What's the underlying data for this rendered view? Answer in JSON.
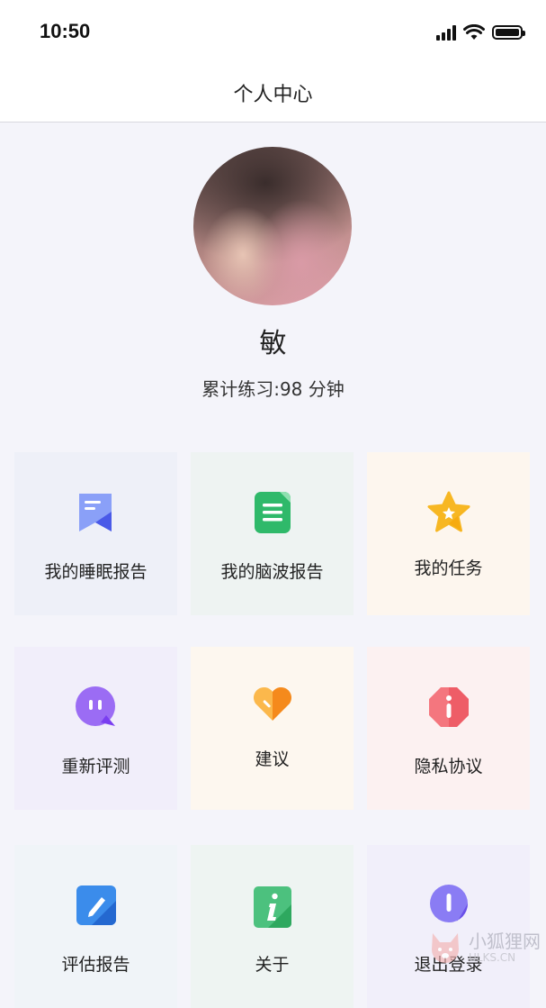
{
  "status_bar": {
    "time": "10:50"
  },
  "header": {
    "title": "个人中心"
  },
  "profile": {
    "name": "敏",
    "practice_text": "累计练习:98 分钟"
  },
  "menu": {
    "items": [
      {
        "label": "我的睡眠报告",
        "icon": "sleep-report-icon",
        "bg": "#eef0f8",
        "color": "#5b6cf0"
      },
      {
        "label": "我的脑波报告",
        "icon": "brainwave-report-icon",
        "bg": "#eef3f2",
        "color": "#2fb96a"
      },
      {
        "label": "我的任务",
        "icon": "star-task-icon",
        "bg": "#fdf6ee",
        "color": "#f5b21c"
      },
      {
        "label": "重新评测",
        "icon": "chat-retest-icon",
        "bg": "#f1eefa",
        "color": "#8a5cf0"
      },
      {
        "label": "建议",
        "icon": "heart-suggestion-icon",
        "bg": "#fdf7ef",
        "color": "#f5a623"
      },
      {
        "label": "隐私协议",
        "icon": "info-privacy-icon",
        "bg": "#fcf1f1",
        "color": "#ef5a64"
      },
      {
        "label": "评估报告",
        "icon": "pen-report-icon",
        "bg": "#f0f4f8",
        "color": "#2f7ee0"
      },
      {
        "label": "关于",
        "icon": "info-about-icon",
        "bg": "#eef4f2",
        "color": "#3cb96e"
      },
      {
        "label": "退出登录",
        "icon": "logout-icon",
        "bg": "#f1effa",
        "color": "#7c6cf0"
      }
    ]
  },
  "watermark": {
    "text": "小狐狸网",
    "sub": "ULKS.CN"
  }
}
